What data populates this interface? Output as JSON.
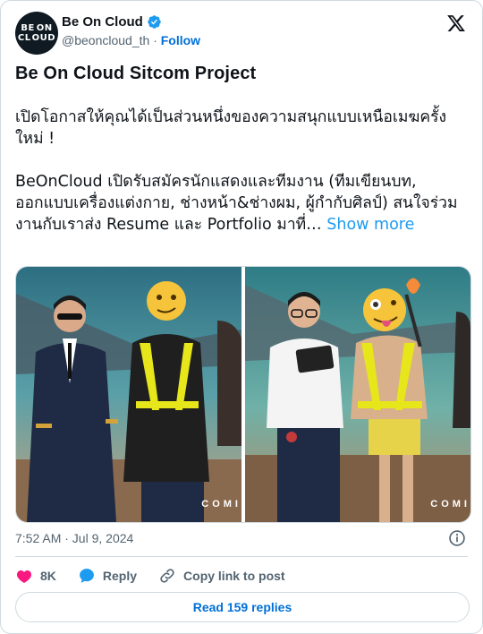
{
  "account": {
    "display_name": "Be On Cloud",
    "handle": "@beoncloud_th",
    "separator": "·",
    "follow_label": "Follow",
    "avatar_text": [
      "BE",
      "ON",
      "CL",
      "OUD"
    ]
  },
  "post": {
    "title": "Be On Cloud Sitcom Project",
    "paragraph1": "เปิดโอกาสให้คุณได้เป็นส่วนหนึ่งของความสนุกแบบเหนือเมฆครั้งใหม่ !",
    "paragraph2": "BeOnCloud เปิดรับสมัครนักแสดงและทีมงาน (ทีมเขียนบท, ออกแบบเครื่องแต่งกาย, ช่างหน้า&ช่างผม, ผู้กำกับศิลป์) สนใจร่วมงานกับเราส่ง Resume และ Portfolio มาที่…",
    "show_more": "Show more",
    "media_overlay_left": "COMI",
    "media_overlay_right": "COMI",
    "timestamp": "7:52 AM · Jul 9, 2024"
  },
  "actions": {
    "likes": "8K",
    "reply_label": "Reply",
    "copy_link_label": "Copy link to post",
    "read_replies_label": "Read 159 replies"
  },
  "colors": {
    "accent": "#1d9bf0",
    "link": "#006fd6",
    "heart": "#f91880",
    "muted": "#536471"
  }
}
